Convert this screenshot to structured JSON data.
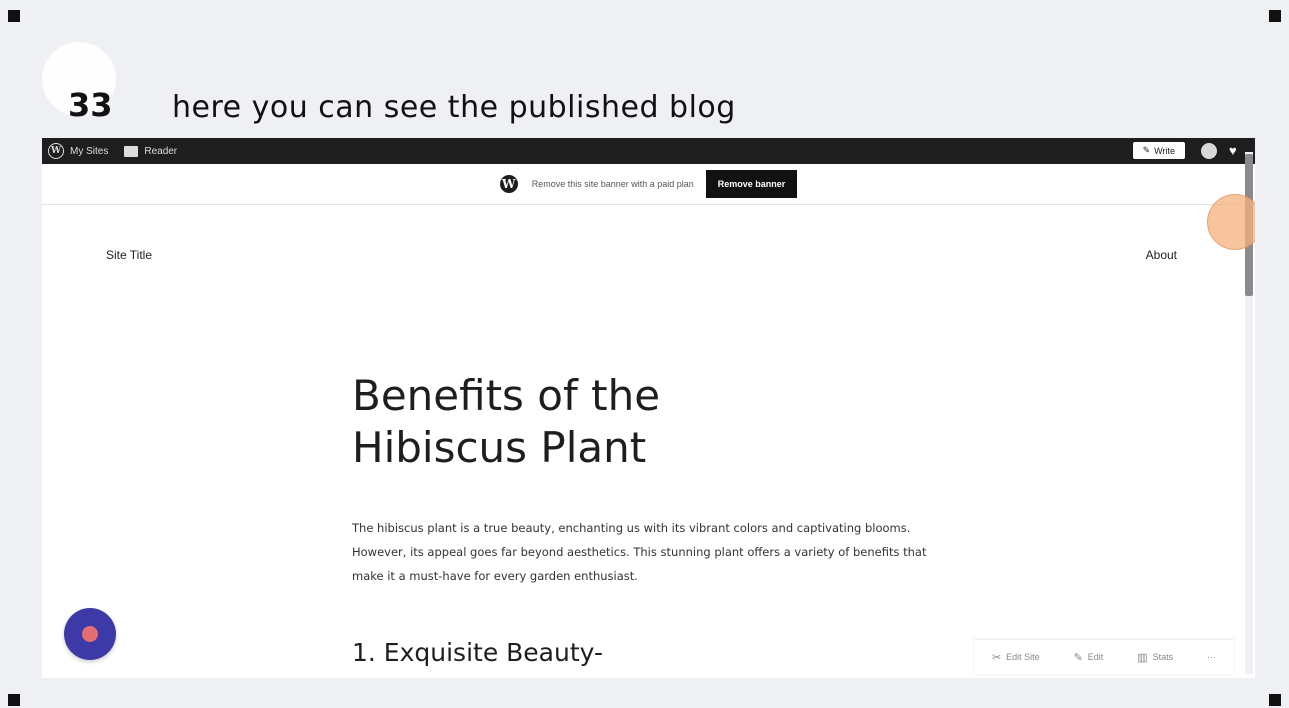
{
  "tutorial": {
    "step_number": "33",
    "caption": "here you can see the published  blog"
  },
  "admin_bar": {
    "my_sites": "My Sites",
    "reader": "Reader",
    "write": "Write"
  },
  "banner": {
    "text": "Remove this site banner with a paid plan",
    "button": "Remove banner"
  },
  "site": {
    "title": "Site Title",
    "nav_about": "About"
  },
  "post": {
    "title_line1": "Benefits of the",
    "title_line2": "Hibiscus Plant",
    "body": "The hibiscus plant is a true beauty, enchanting us with its vibrant colors and captivating blooms. However, its appeal goes far beyond aesthetics. This stunning plant offers a variety of benefits that make it a must-have for every garden enthusiast.",
    "heading": "1. Exquisite Beauty-"
  },
  "actions": {
    "edit_site": "Edit Site",
    "edit": "Edit",
    "stats": "Stats",
    "more": "···"
  },
  "colors": {
    "admin_bar": "#1e1e1e",
    "help_bubble": "#3d3aa8",
    "cursor_highlight": "#f4b07c"
  }
}
